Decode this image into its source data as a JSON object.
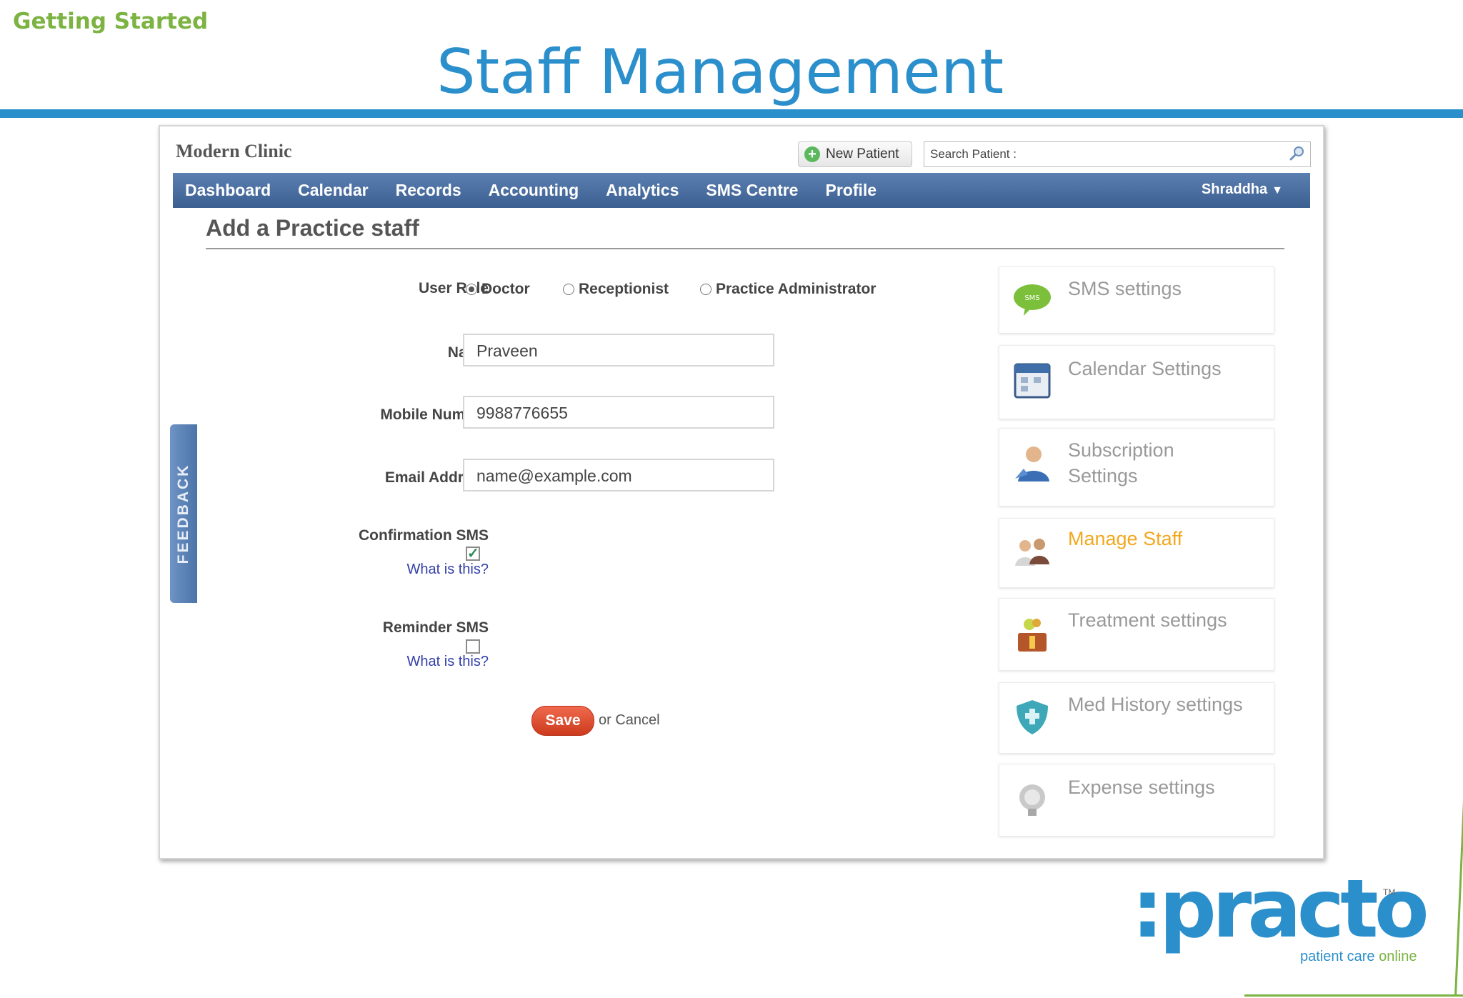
{
  "slide": {
    "section_label": "Getting Started",
    "title": "Staff Management"
  },
  "app": {
    "clinic_name": "Modern Clinic",
    "new_patient_label": "New Patient",
    "search_placeholder": "Search Patient :",
    "nav": {
      "items": [
        {
          "label": "Dashboard"
        },
        {
          "label": "Calendar"
        },
        {
          "label": "Records"
        },
        {
          "label": "Accounting"
        },
        {
          "label": "Analytics"
        },
        {
          "label": "SMS Centre"
        },
        {
          "label": "Profile"
        }
      ],
      "user": "Shraddha"
    },
    "feedback_label": "FEEDBACK"
  },
  "form": {
    "title": "Add a Practice staff",
    "user_role": {
      "label": "User Role",
      "options": [
        {
          "label": "Doctor",
          "selected": true
        },
        {
          "label": "Receptionist",
          "selected": false
        },
        {
          "label": "Practice Administrator",
          "selected": false
        }
      ]
    },
    "name": {
      "label": "Name",
      "value": "Praveen"
    },
    "mobile": {
      "label": "Mobile Number",
      "value": "9988776655"
    },
    "email": {
      "label": "Email Address",
      "value": "name@example.com"
    },
    "confirmation_sms": {
      "label": "Confirmation SMS",
      "help": "What is this?",
      "checked": true
    },
    "reminder_sms": {
      "label": "Reminder SMS",
      "help": "What is this?",
      "checked": false
    },
    "save_label": "Save",
    "or_label": "or",
    "cancel_label": "Cancel"
  },
  "sidebar": {
    "items": [
      {
        "label": "SMS settings",
        "icon": "sms-bubble-icon"
      },
      {
        "label": "Calendar Settings",
        "icon": "calendar-icon"
      },
      {
        "label": "Subscription Settings",
        "icon": "user-icon"
      },
      {
        "label": "Manage Staff",
        "icon": "staff-icon",
        "active": true
      },
      {
        "label": "Treatment settings",
        "icon": "treatment-icon"
      },
      {
        "label": "Med History settings",
        "icon": "shield-icon"
      },
      {
        "label": "Expense settings",
        "icon": "expense-icon"
      }
    ]
  },
  "logo": {
    "word": ":practo",
    "tm": "TM",
    "tagline_main": "patient care ",
    "tagline_accent": "online"
  },
  "colors": {
    "brand_blue": "#2b8fcc",
    "brand_green": "#7cb342",
    "nav_blue": "#4a6da0",
    "active_orange": "#f2a81d",
    "save_red": "#e0502f"
  }
}
